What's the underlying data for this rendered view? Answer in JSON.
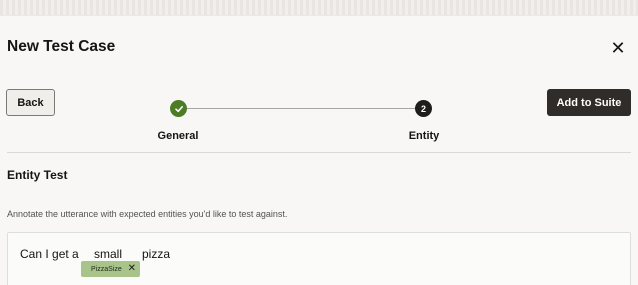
{
  "dialog": {
    "title": "New Test Case",
    "close_icon": "close-icon"
  },
  "toolbar": {
    "back_label": "Back",
    "add_label": "Add to Suite"
  },
  "steps": [
    {
      "label": "General",
      "status": "completed",
      "icon": "check-icon"
    },
    {
      "label": "Entity",
      "status": "current",
      "number": "2"
    }
  ],
  "section": {
    "title": "Entity Test",
    "helper": "Annotate the utterance with expected entities you'd like to test against."
  },
  "utterance": {
    "words": [
      "Can I get a",
      "small",
      "pizza"
    ],
    "entity": {
      "label": "PizzaSize",
      "annotated_word": "small"
    }
  },
  "colors": {
    "completed_step": "#4d7c26",
    "current_step": "#1f1d1b",
    "primary_button": "#2f2c29",
    "entity_chip": "#a8c48b"
  }
}
